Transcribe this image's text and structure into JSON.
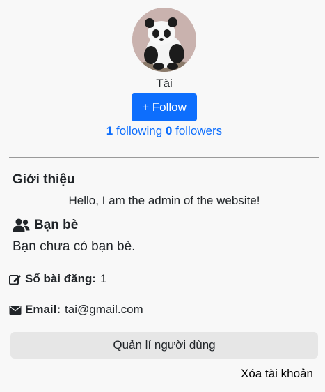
{
  "profile": {
    "username": "Tài",
    "follow_label": "+ Follow",
    "following_count": "1",
    "following_label": "following",
    "followers_count": "0",
    "followers_label": "followers"
  },
  "intro": {
    "title": "Giới thiệu",
    "text": "Hello, I am the admin of the website!"
  },
  "friends": {
    "icon": "users-icon",
    "title": "Bạn bè",
    "empty_text": "Bạn chưa có bạn bè."
  },
  "info": {
    "posts_icon": "edit-icon",
    "posts_label": "Số bài đăng:",
    "posts_value": "1",
    "email_icon": "envelope-icon",
    "email_label": "Email:",
    "email_value": "tai@gmail.com"
  },
  "actions": {
    "manage_label": "Quản lí người dùng",
    "delete_label": "Xóa tài khoản"
  },
  "colors": {
    "primary": "#0d6efd",
    "background": "#f8f8f8",
    "manage_bg": "#e6e6e6"
  }
}
